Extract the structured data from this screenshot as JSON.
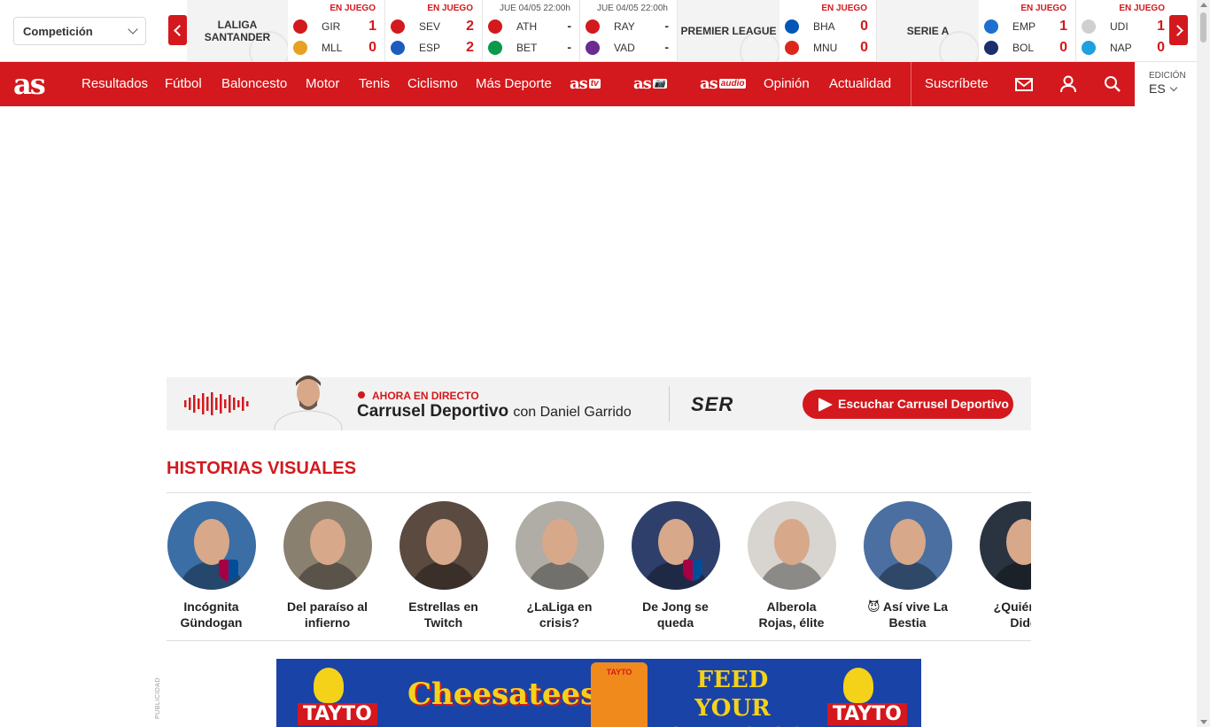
{
  "scoreboard": {
    "competition_select": "Competición",
    "leagues": [
      {
        "name": "LALIGA SANTANDER"
      },
      {
        "name": "PREMIER LEAGUE"
      },
      {
        "name": "SERIE A"
      }
    ],
    "matches": [
      {
        "status": "EN JUEGO",
        "home": "GIR",
        "away": "MLL",
        "home_score": "1",
        "away_score": "0",
        "home_color": "#d3191d",
        "away_color": "#e8a020"
      },
      {
        "status": "EN JUEGO",
        "home": "SEV",
        "away": "ESP",
        "home_score": "2",
        "away_score": "2",
        "home_color": "#d3191d",
        "away_color": "#1d5bbf"
      },
      {
        "status": "JUE 04/05 22:00h",
        "home": "ATH",
        "away": "BET",
        "home_score": "-",
        "away_score": "-",
        "home_color": "#d3191d",
        "away_color": "#0a9a4a"
      },
      {
        "status": "JUE 04/05 22:00h",
        "home": "RAY",
        "away": "VAD",
        "home_score": "-",
        "away_score": "-",
        "home_color": "#d3191d",
        "away_color": "#6a2c91"
      },
      {
        "status": "EN JUEGO",
        "home": "BHA",
        "away": "MNU",
        "home_score": "0",
        "away_score": "0",
        "home_color": "#0057b8",
        "away_color": "#da291c"
      },
      {
        "status": "EN JUEGO",
        "home": "EMP",
        "away": "BOL",
        "home_score": "1",
        "away_score": "0",
        "home_color": "#1e6fd0",
        "away_color": "#1a2f6b"
      },
      {
        "status": "EN JUEGO",
        "home": "UDI",
        "away": "NAP",
        "home_score": "1",
        "away_score": "0",
        "home_color": "#cfcfcf",
        "away_color": "#1fa0e0"
      }
    ]
  },
  "nav": {
    "logo": "as",
    "items": [
      "Resultados",
      "Fútbol",
      "Baloncesto",
      "Motor",
      "Tenis",
      "Ciclismo",
      "Más Deporte"
    ],
    "sublogos": [
      {
        "text": "as",
        "tag": "tv"
      },
      {
        "text": "as",
        "tag": "📷"
      },
      {
        "text": "as",
        "tag": "audio"
      }
    ],
    "items_right": [
      "Opinión",
      "Actualidad"
    ],
    "subscribe": "Suscríbete",
    "icons": [
      "mail-icon",
      "user-icon",
      "search-icon"
    ],
    "edition_label": "EDICIÓN",
    "edition_value": "ES"
  },
  "radio": {
    "live_label": "AHORA EN DIRECTO",
    "show_name": "Carrusel Deportivo",
    "host": "con Daniel Garrido",
    "station": "SER",
    "button_label": "Escuchar Carrusel Deportivo"
  },
  "stories": {
    "title": "HISTORIAS VISUALES",
    "items": [
      {
        "caption": "Incógnita Gündogan",
        "bg": "#3a6ea5"
      },
      {
        "caption": "Del paraíso al infierno",
        "bg": "#8a8070"
      },
      {
        "caption": "Estrellas en Twitch",
        "bg": "#5a4a40"
      },
      {
        "caption": "¿LaLiga en crisis?",
        "bg": "#b0aca6"
      },
      {
        "caption": "De Jong se queda",
        "bg": "#2e3f6b"
      },
      {
        "caption": "Alberola Rojas, élite",
        "bg": "#d8d4cf"
      },
      {
        "caption": "😈 Así vive La Bestia",
        "bg": "#4a6fa0"
      },
      {
        "caption": "¿Quién es Dide",
        "bg": "#2a3440"
      }
    ]
  },
  "ad": {
    "label": "PUBLICIDAD",
    "brand": "TAYTO",
    "product": "Cheesatees",
    "slogan": "FEED YOUR CHEESIOSITY"
  }
}
